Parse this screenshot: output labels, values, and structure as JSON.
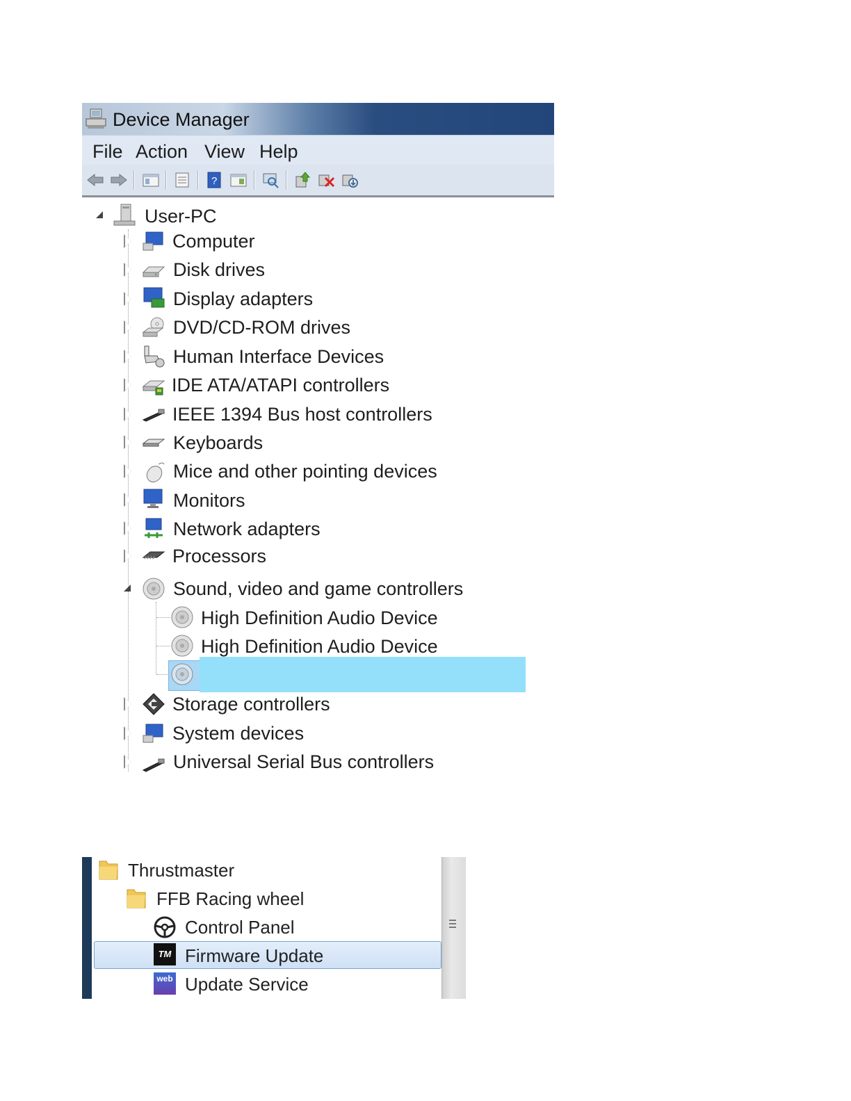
{
  "window": {
    "title": "Device Manager"
  },
  "menu": [
    "File",
    "Action",
    "View",
    "Help"
  ],
  "toolbar_icons": [
    "back-icon",
    "forward-icon",
    "show-hide-tree-icon",
    "properties-icon",
    "help-icon",
    "view-icon",
    "scan-hardware-icon",
    "update-driver-icon",
    "uninstall-icon",
    "disable-device-icon"
  ],
  "tree": {
    "root": "User-PC",
    "categories": [
      "Computer",
      "Disk drives",
      "Display adapters",
      "DVD/CD-ROM drives",
      "Human Interface Devices",
      "IDE ATA/ATAPI controllers",
      "IEEE 1394 Bus host controllers",
      "Keyboards",
      "Mice and other pointing devices",
      "Monitors",
      "Network adapters",
      "Processors",
      "Sound, video and game controllers",
      "Storage controllers",
      "System devices",
      "Universal Serial Bus controllers"
    ],
    "sound_children": [
      "High Definition Audio Device",
      "High Definition Audio Device",
      ""
    ]
  },
  "colors": {
    "selection": "#94e0fb"
  },
  "start_menu": {
    "items": [
      "Thrustmaster",
      "FFB Racing wheel",
      "Control Panel",
      "Firmware Update",
      "Update Service"
    ],
    "tm_badge": "TM",
    "web_badge": "web"
  }
}
